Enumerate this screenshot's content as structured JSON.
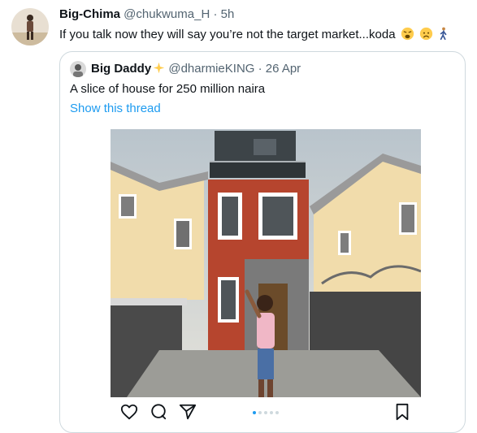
{
  "tweet": {
    "author_name": "Big-Chima",
    "author_handle": "@chukwuma_H",
    "separator": " · ",
    "time": "5h",
    "text": "If you talk now they will say you’re not the target market...koda",
    "emojis": [
      "weary-face-emoji",
      "worried-face-emoji",
      "person-walking-emoji"
    ]
  },
  "quoted_tweet": {
    "author_name": "Big Daddy",
    "author_handle": "@dharmieKING",
    "separator": " · ",
    "date": "26 Apr",
    "text": "A slice of house for 250 million naira",
    "thread_link": "Show this thread",
    "carousel": {
      "count": 5,
      "active_index": 0
    }
  },
  "icons": {
    "like": "heart-icon",
    "comment": "comment-icon",
    "share": "send-icon",
    "save": "bookmark-icon"
  },
  "colors": {
    "link": "#1d9bf0",
    "secondary_text": "#536471",
    "border": "#cfd9de"
  }
}
